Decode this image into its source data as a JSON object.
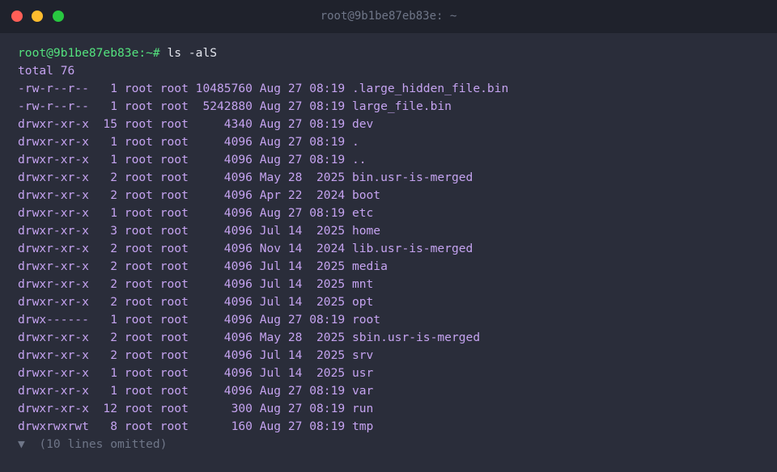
{
  "window": {
    "title": "root@9b1be87eb83e: ~",
    "traffic_lights": [
      {
        "name": "close",
        "color": "#ff5f57"
      },
      {
        "name": "minimize",
        "color": "#febc2e"
      },
      {
        "name": "zoom",
        "color": "#28c840"
      }
    ]
  },
  "colors": {
    "background": "#2a2d3a",
    "titlebar": "#1f222c",
    "prompt": "#54e27e",
    "output": "#c5a3f0",
    "command": "#e4e6ee",
    "muted": "#6f7688"
  },
  "terminal": {
    "prompt": "root@9b1be87eb83e:~#",
    "command": " ls -alS",
    "total": "total 76",
    "entries": [
      "-rw-r--r--   1 root root 10485760 Aug 27 08:19 .large_hidden_file.bin",
      "-rw-r--r--   1 root root  5242880 Aug 27 08:19 large_file.bin",
      "drwxr-xr-x  15 root root     4340 Aug 27 08:19 dev",
      "drwxr-xr-x   1 root root     4096 Aug 27 08:19 .",
      "drwxr-xr-x   1 root root     4096 Aug 27 08:19 ..",
      "drwxr-xr-x   2 root root     4096 May 28  2025 bin.usr-is-merged",
      "drwxr-xr-x   2 root root     4096 Apr 22  2024 boot",
      "drwxr-xr-x   1 root root     4096 Aug 27 08:19 etc",
      "drwxr-xr-x   3 root root     4096 Jul 14  2025 home",
      "drwxr-xr-x   2 root root     4096 Nov 14  2024 lib.usr-is-merged",
      "drwxr-xr-x   2 root root     4096 Jul 14  2025 media",
      "drwxr-xr-x   2 root root     4096 Jul 14  2025 mnt",
      "drwxr-xr-x   2 root root     4096 Jul 14  2025 opt",
      "drwx------   1 root root     4096 Aug 27 08:19 root",
      "drwxr-xr-x   2 root root     4096 May 28  2025 sbin.usr-is-merged",
      "drwxr-xr-x   2 root root     4096 Jul 14  2025 srv",
      "drwxr-xr-x   1 root root     4096 Jul 14  2025 usr",
      "drwxr-xr-x   1 root root     4096 Aug 27 08:19 var",
      "drwxr-xr-x  12 root root      300 Aug 27 08:19 run",
      "drwxrwxrwt   8 root root      160 Aug 27 08:19 tmp"
    ],
    "omitted": "▼  (10 lines omitted)"
  }
}
